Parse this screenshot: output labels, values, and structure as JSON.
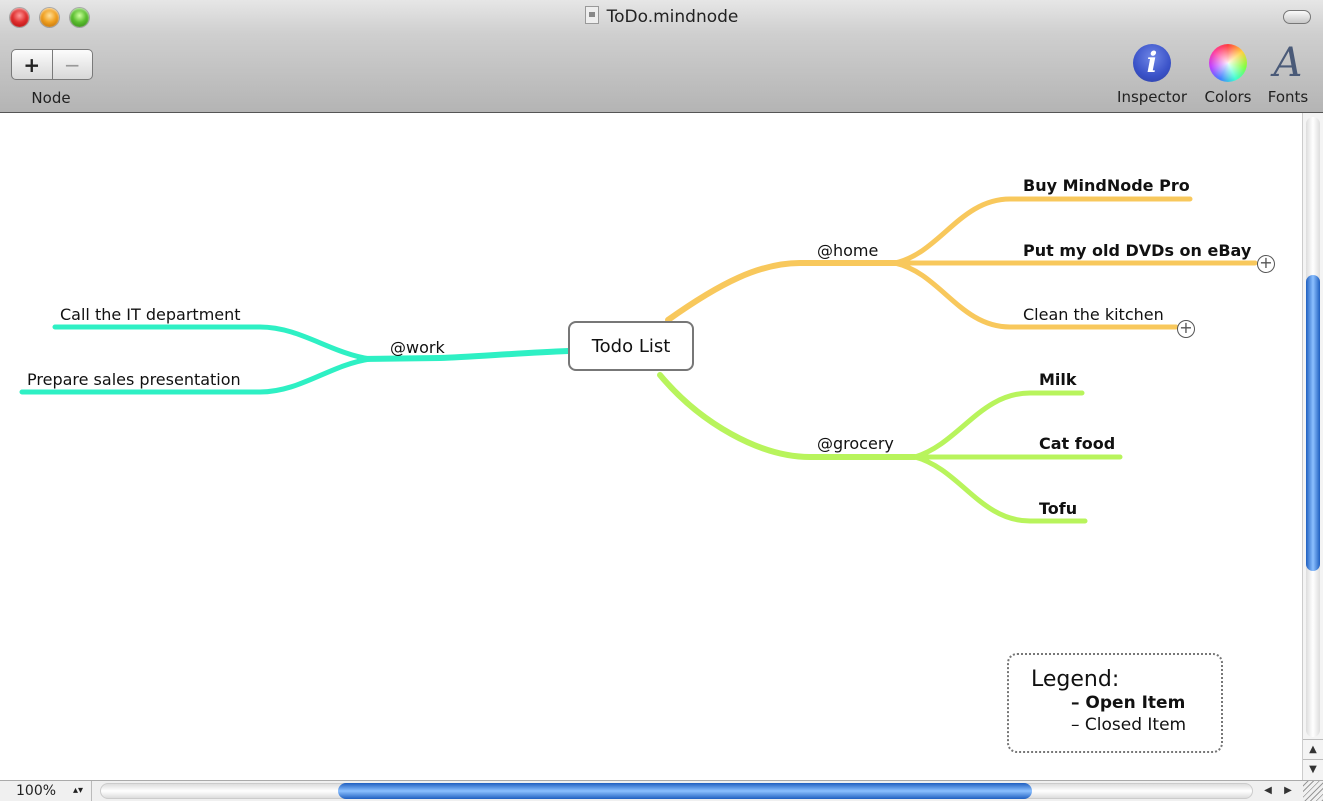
{
  "window": {
    "title": "ToDo.mindnode"
  },
  "toolbar": {
    "node_group_label": "Node",
    "add_node_label": "+",
    "remove_node_label": "−",
    "inspector_label": "Inspector",
    "inspector_glyph": "i",
    "colors_label": "Colors",
    "fonts_label": "Fonts",
    "fonts_glyph": "A"
  },
  "mindmap": {
    "root": "Todo List",
    "branches": [
      {
        "label": "@work",
        "color": "#2ef0c4",
        "children": [
          {
            "label": "Call the IT department",
            "status": "closed"
          },
          {
            "label": "Prepare sales presentation",
            "status": "closed"
          }
        ]
      },
      {
        "label": "@home",
        "color": "#f8c85c",
        "children": [
          {
            "label": "Buy MindNode Pro",
            "status": "open"
          },
          {
            "label": "Put my old DVDs on eBay",
            "status": "open",
            "collapsed_children": true
          },
          {
            "label": "Clean the kitchen",
            "status": "closed",
            "collapsed_children": true
          }
        ]
      },
      {
        "label": "@grocery",
        "color": "#b8f45c",
        "children": [
          {
            "label": "Milk",
            "status": "open"
          },
          {
            "label": "Cat food",
            "status": "open"
          },
          {
            "label": "Tofu",
            "status": "open"
          }
        ]
      }
    ],
    "expand_glyph": "+"
  },
  "legend": {
    "title": "Legend:",
    "items": [
      {
        "label": "– Open Item",
        "style": "bold"
      },
      {
        "label": "– Closed Item",
        "style": "normal"
      }
    ]
  },
  "statusbar": {
    "zoom": "100%"
  },
  "scroll": {
    "vertical_position_fraction": 0.42,
    "horizontal_position_fraction": 0.5
  }
}
